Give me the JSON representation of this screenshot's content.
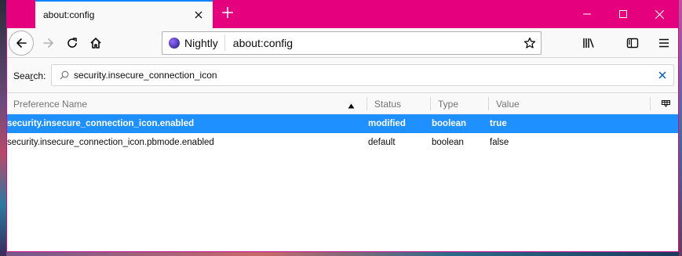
{
  "window": {
    "tab_title": "about:config",
    "new_tab_label": "+",
    "controls": {
      "minimize": "—",
      "maximize": "☐",
      "close": "✕"
    }
  },
  "navbar": {
    "identity_label": "Nightly",
    "url": "about:config"
  },
  "search": {
    "label_prefix": "Sea",
    "label_accesskey": "r",
    "label_suffix": "ch:",
    "value": "security.insecure_connection_icon"
  },
  "table": {
    "columns": {
      "name": "Preference Name",
      "status": "Status",
      "type": "Type",
      "value": "Value"
    },
    "rows": [
      {
        "name": "security.insecure_connection_icon.enabled",
        "status": "modified",
        "type": "boolean",
        "value": "true",
        "selected": true
      },
      {
        "name": "security.insecure_connection_icon.pbmode.enabled",
        "status": "default",
        "type": "boolean",
        "value": "false",
        "selected": false
      }
    ]
  },
  "colors": {
    "titlebar": "#e5007e",
    "tab_accent": "#0a84ff",
    "selection": "#1e90ff"
  },
  "icons": [
    "back-icon",
    "forward-icon",
    "reload-icon",
    "home-icon",
    "star-icon",
    "library-icon",
    "sidebar-icon",
    "menu-icon",
    "search-icon",
    "clear-icon",
    "column-picker-icon",
    "sort-ascending-icon"
  ]
}
